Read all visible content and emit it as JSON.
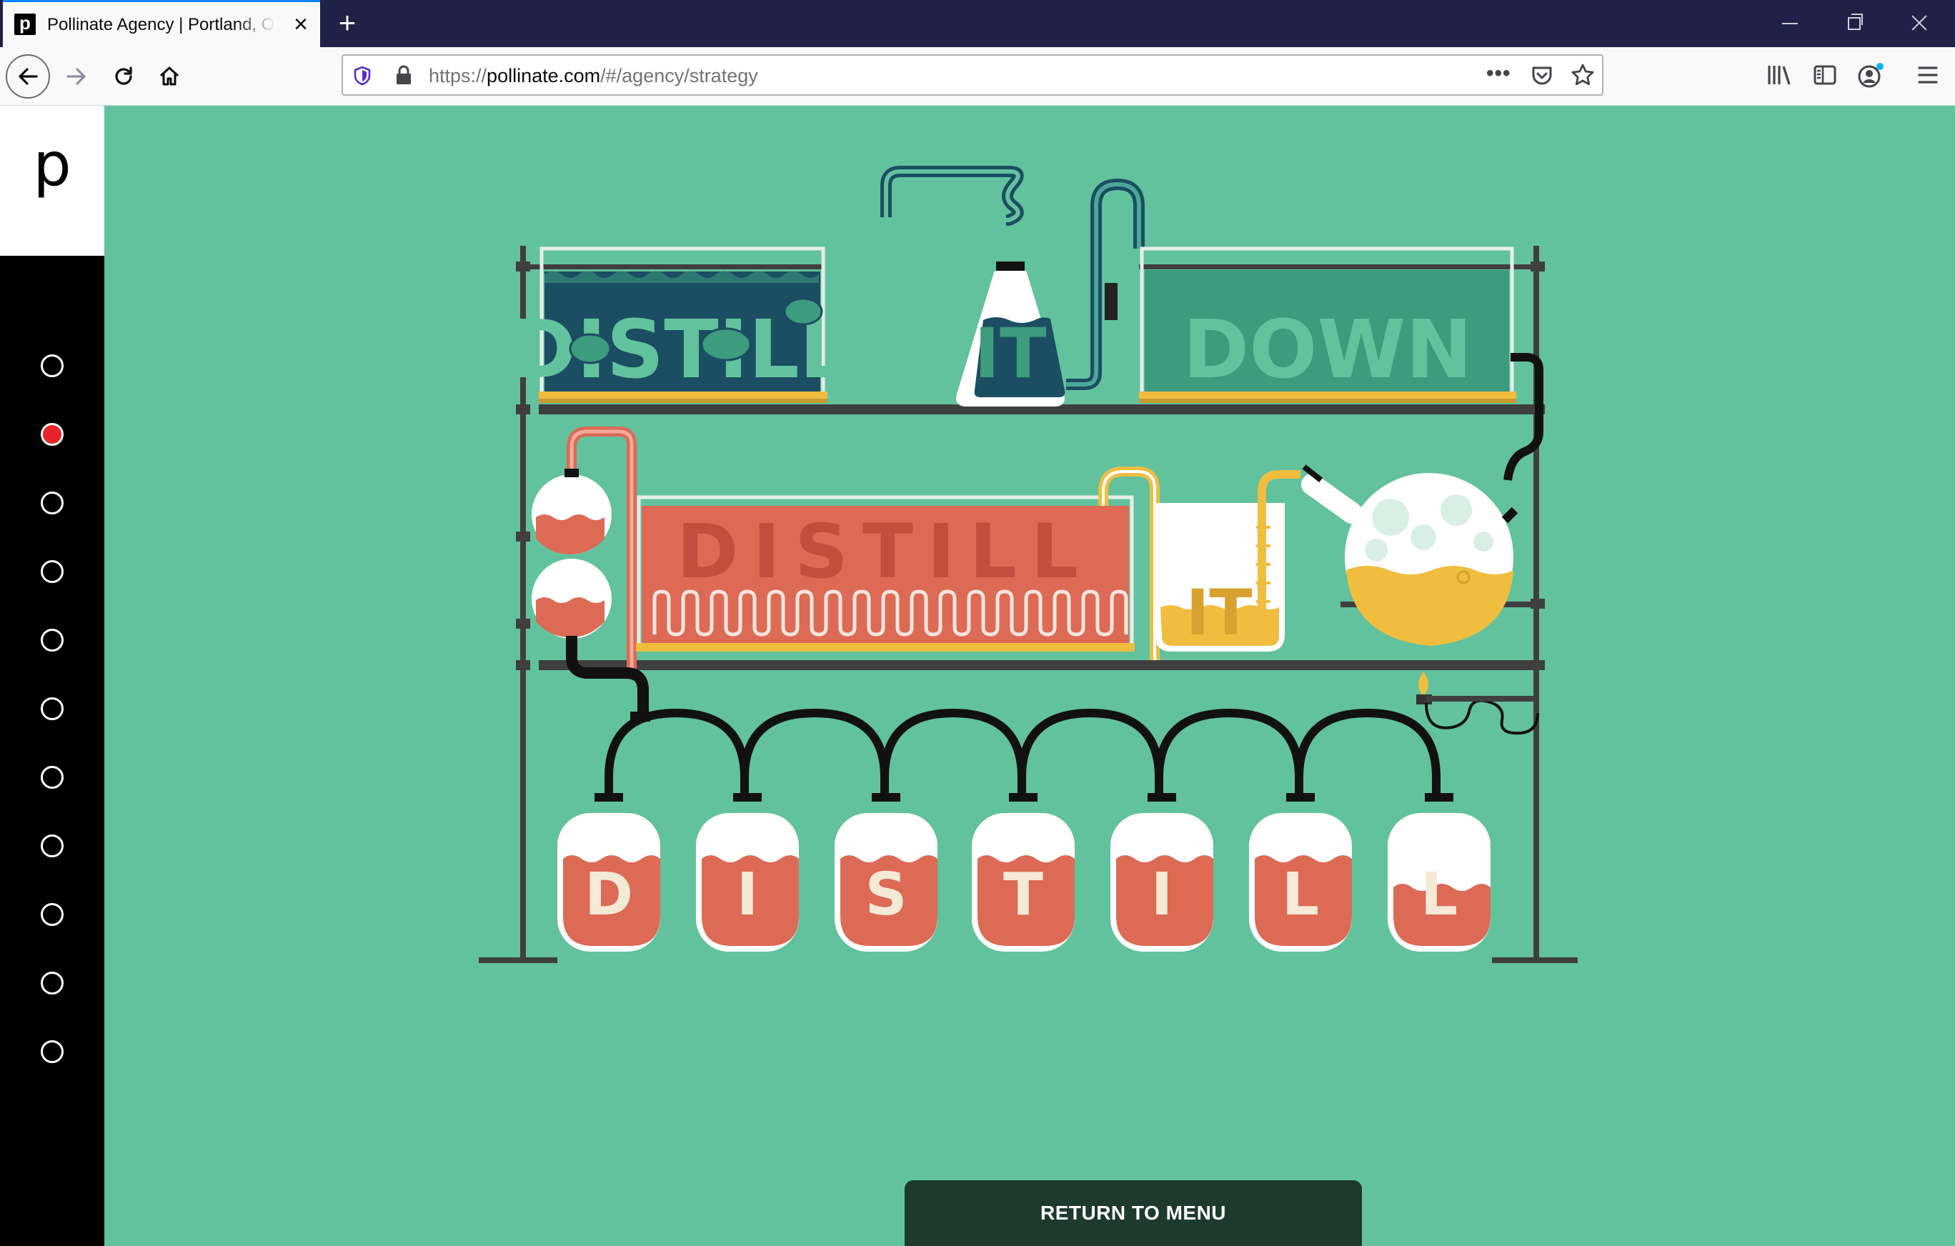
{
  "browser": {
    "tab_title": "Pollinate Agency | Portland, Oregon",
    "tab_favicon_letter": "p",
    "url_prefix": "https://",
    "url_host": "pollinate.com",
    "url_path": "/#/agency/strategy",
    "more_label": "•••"
  },
  "sidebar": {
    "logo": "p",
    "dots": [
      {
        "active": false
      },
      {
        "active": true
      },
      {
        "active": false
      },
      {
        "active": false
      },
      {
        "active": false
      },
      {
        "active": false
      },
      {
        "active": false
      },
      {
        "active": false
      },
      {
        "active": false
      },
      {
        "active": false
      },
      {
        "active": false
      }
    ]
  },
  "illustration": {
    "top_tank_left": "DISTILL",
    "top_flask": "IT",
    "top_tank_right": "DOWN",
    "middle_tank": "DISTILL",
    "middle_beaker": "IT",
    "jars": [
      "D",
      "I",
      "S",
      "T",
      "I",
      "L",
      "L"
    ],
    "colors": {
      "background": "#62c29d",
      "dark_teal": "#1b4e62",
      "muted_teal": "#3d9b7e",
      "coral": "#dd6a55",
      "gold": "#f0bd3f",
      "frame": "#3f3f3f"
    }
  },
  "cta": {
    "return_label": "RETURN TO MENU"
  }
}
